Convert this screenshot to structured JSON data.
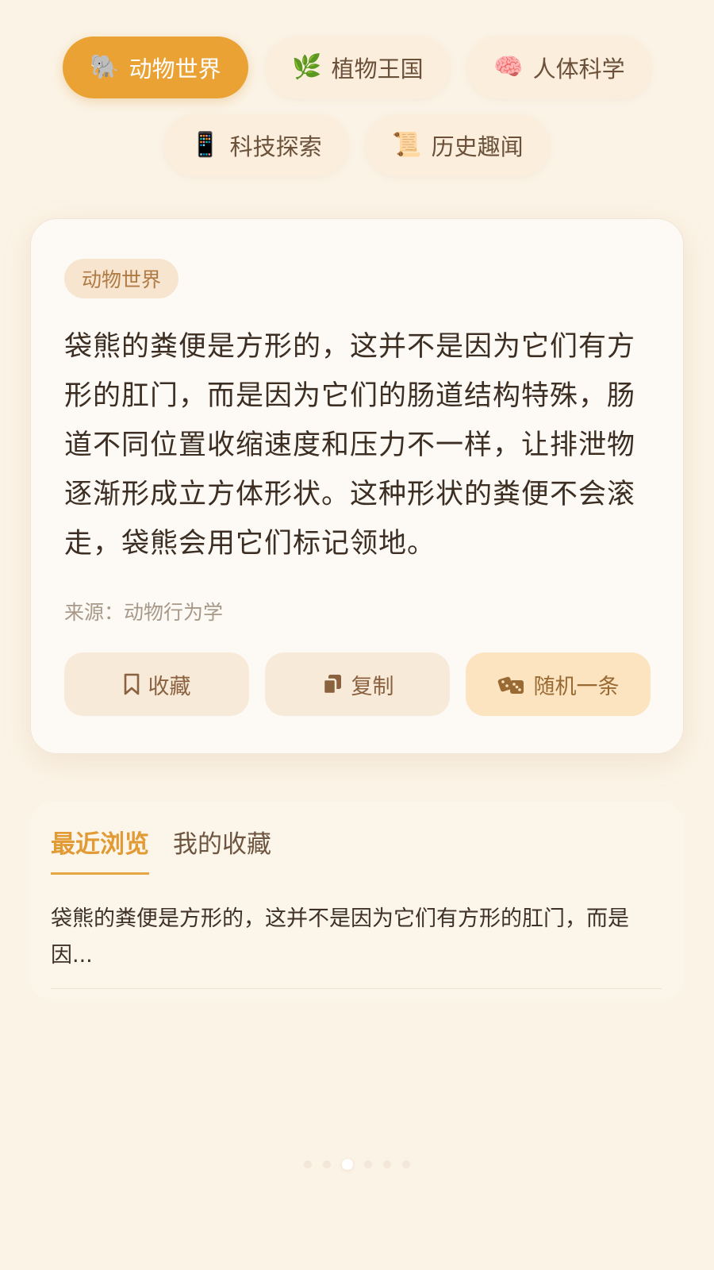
{
  "categories": [
    {
      "icon": "🐘",
      "label": "动物世界",
      "active": true
    },
    {
      "icon": "🌿",
      "label": "植物王国",
      "active": false
    },
    {
      "icon": "🧠",
      "label": "人体科学",
      "active": false
    },
    {
      "icon": "📱",
      "label": "科技探索",
      "active": false
    },
    {
      "icon": "📜",
      "label": "历史趣闻",
      "active": false
    }
  ],
  "card": {
    "tag": "动物世界",
    "fact": "袋熊的粪便是方形的，这并不是因为它们有方形的肛门，而是因为它们的肠道结构特殊，肠道不同位置收缩速度和压力不一样，让排泄物逐渐形成立方体形状。这种形状的粪便不会滚走，袋熊会用它们标记领地。",
    "source": "来源：动物行为学",
    "actions": {
      "favorite_label": "收藏",
      "copy_label": "复制",
      "random_label": "随机一条"
    }
  },
  "history": {
    "tabs": [
      {
        "label": "最近浏览",
        "active": true
      },
      {
        "label": "我的收藏",
        "active": false
      }
    ],
    "items": [
      "袋熊的粪便是方形的，这并不是因为它们有方形的肛门，而是因..."
    ]
  },
  "pager": {
    "count": 6,
    "active_index": 2
  },
  "colors": {
    "accent": "#eba234",
    "background": "#fbf3e6",
    "chip": "#fbeedd"
  }
}
